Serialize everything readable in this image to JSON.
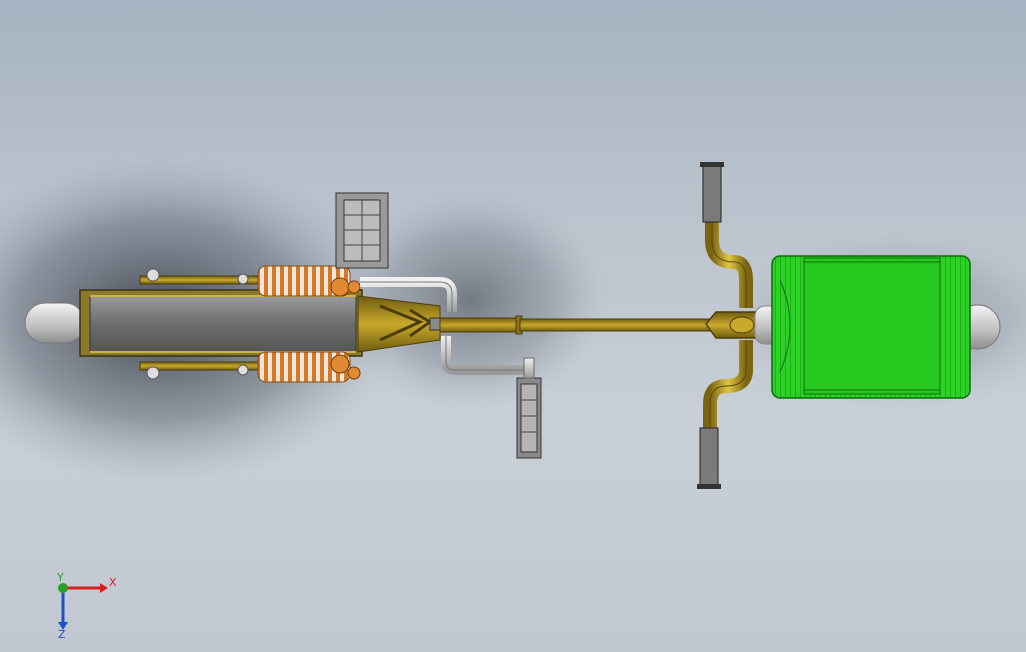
{
  "viewport": {
    "colors": {
      "frame_brass": "#a68a1e",
      "frame_dark": "#6f5c10",
      "tire_gray": "#6a6a6a",
      "spring_orange": "#d4792a",
      "basket_green": "#22c51e",
      "hub_light": "#d9d9d9"
    }
  },
  "triad": {
    "x_label": "X",
    "y_label": "Y",
    "z_label": "Z",
    "colors": {
      "x": "#d62020",
      "y": "#2aa02a",
      "z": "#2050c8"
    }
  }
}
